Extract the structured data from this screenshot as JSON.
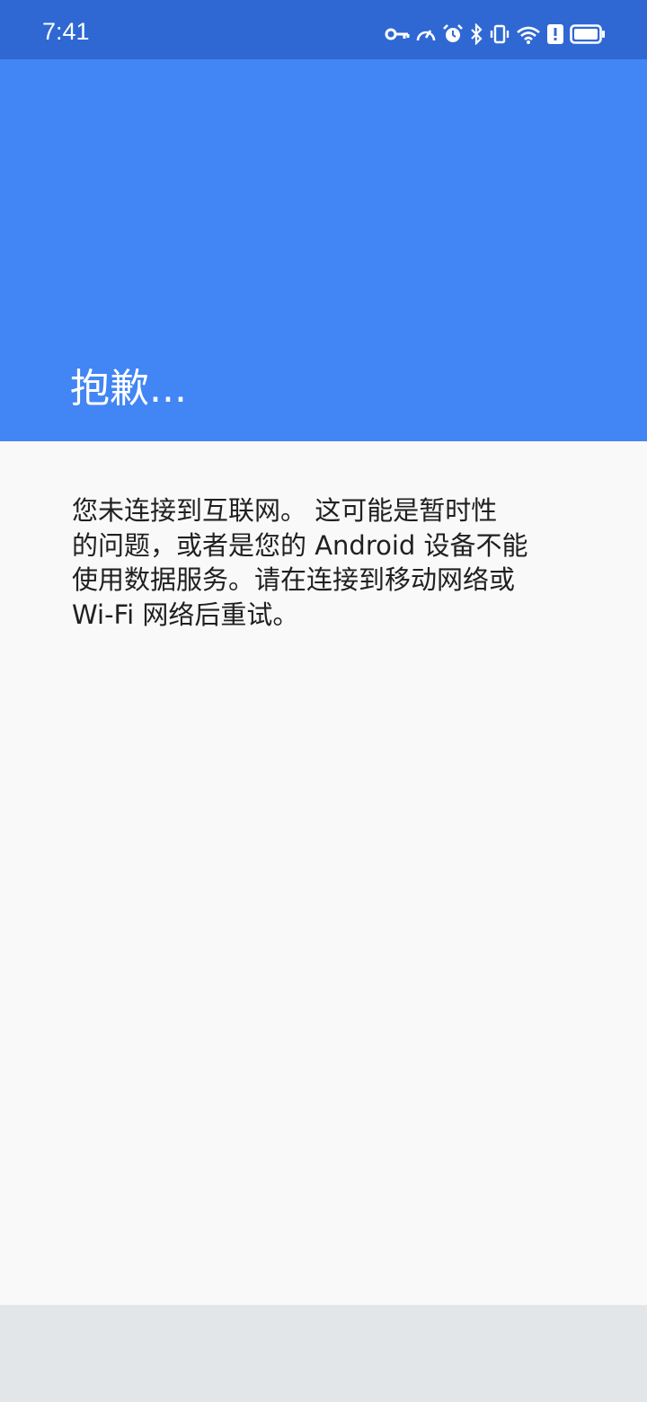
{
  "status_bar": {
    "time": "7:41",
    "icons": [
      "vpn-key-icon",
      "speedometer-icon",
      "alarm-icon",
      "bluetooth-icon",
      "vibrate-icon",
      "wifi-6-icon",
      "alert-icon",
      "battery-icon"
    ],
    "background": "#2f68d3"
  },
  "header": {
    "title": "抱歉...",
    "background": "#4285f4"
  },
  "message": {
    "lines": [
      "您未连接到互联网。 这可能是暂时性",
      "的问题，或者是您的 Android 设备不能",
      "使用数据服务。请在连接到移动网络或",
      "Wi-Fi 网络后重试。"
    ]
  },
  "colors": {
    "content_background": "#f9f9f9",
    "bottom_bar": "#e3e6e9",
    "text": "#202020"
  }
}
